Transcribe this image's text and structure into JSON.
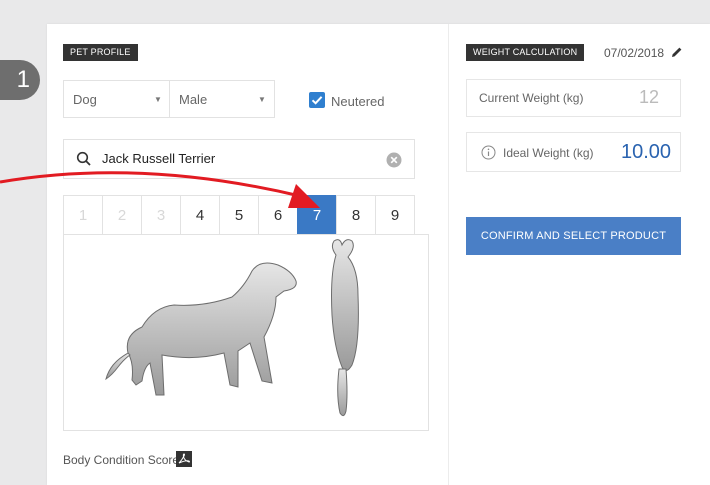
{
  "step": {
    "number": "1"
  },
  "pet_profile": {
    "tag": "PET PROFILE",
    "species": "Dog",
    "sex": "Male",
    "neutered_label": "Neutered",
    "neutered_checked": true,
    "breed": "Jack Russell Terrier",
    "scores": [
      "1",
      "2",
      "3",
      "4",
      "5",
      "6",
      "7",
      "8",
      "9"
    ],
    "selected_score": "7",
    "body_condition_label": "Body Condition Score"
  },
  "weight": {
    "tag": "WEIGHT CALCULATION",
    "date": "07/02/2018",
    "current_label": "Current Weight (kg)",
    "current_value": "12",
    "ideal_label": "Ideal Weight (kg)",
    "ideal_value": "10.00",
    "confirm_label": "CONFIRM AND SELECT PRODUCT"
  },
  "colors": {
    "accent": "#3a79c5",
    "arrow": "#e21b22"
  }
}
